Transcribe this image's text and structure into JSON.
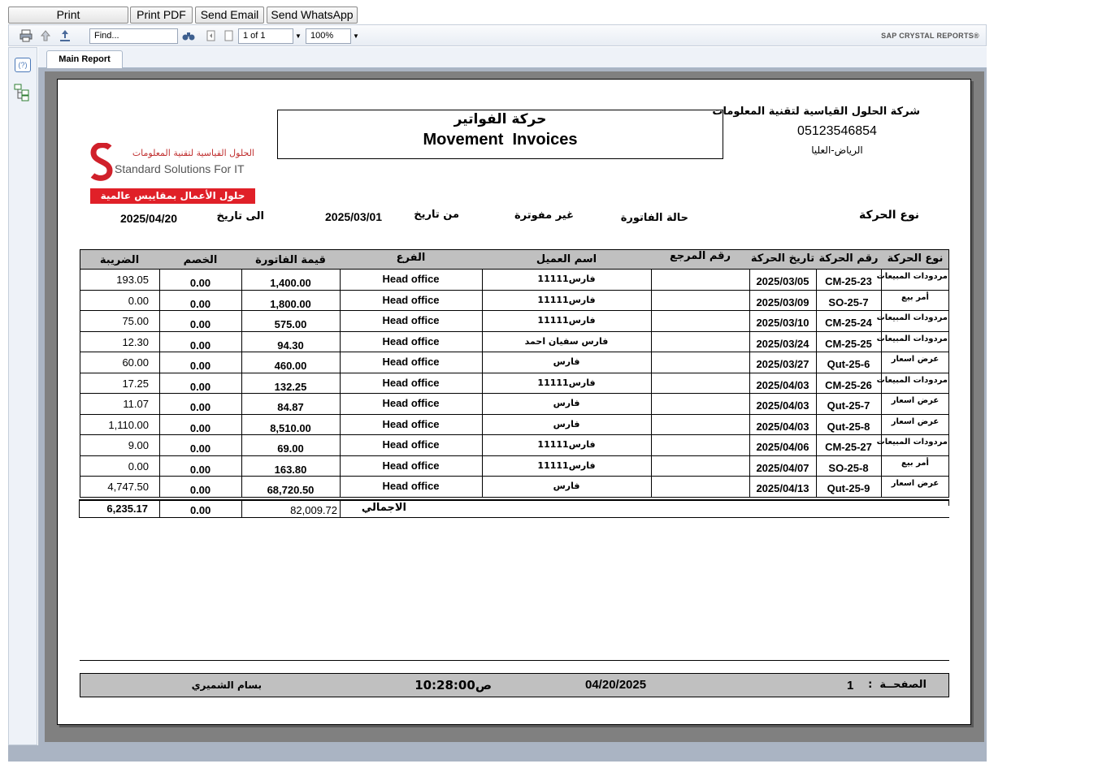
{
  "top_buttons": {
    "print": "Print",
    "print_pdf": "Print PDF",
    "send_email": "Send Email",
    "send_whatsapp": "Send WhatsApp"
  },
  "toolbar": {
    "find_placeholder": "Find...",
    "page_indicator": "1 of 1",
    "zoom": "100%",
    "brand": "SAP CRYSTAL REPORTS®"
  },
  "tab": {
    "label": "Main Report"
  },
  "leftpanel": {
    "help_label": "(?)"
  },
  "report": {
    "company_name": "شركة الحلول القياسية لتقنية المعلومات",
    "phone": "05123546854",
    "city": "الرياض-العليا",
    "title_ar": "حركة الفواتير",
    "title_en": "Movement  Invoices",
    "logo": {
      "ar_top": "الحلول القياسية لتقنية المعلومات",
      "en": "Standard Solutions For IT",
      "ar_banner": "حلول الأعمال بمقاييس عالمية"
    },
    "filters": {
      "to_date_label": "الى تاريخ",
      "to_date": "2025/04/20",
      "from_date_label": "من تاريخ",
      "from_date": "2025/03/01",
      "status_value": "غير مفوترة",
      "status_label": "حالة الفاتورة",
      "type_label": "نوع الحركة"
    },
    "columns": {
      "type": "نوع الحركة",
      "number": "رقم الحركة",
      "date": "تاريخ الحركة",
      "ref": "رقم المرجع",
      "customer": "اسم العميل",
      "branch": "الفرع",
      "amount": "قيمة الفاتورة",
      "discount": "الخصم",
      "tax": "الضريبة"
    },
    "rows": [
      {
        "type": "مردودات المبيعات",
        "number": "CM-25-23",
        "date": "2025/03/05",
        "ref": "",
        "customer": "فارس11111",
        "branch": "Head office",
        "amount": "1,400.00",
        "discount": "0.00",
        "tax": "193.05"
      },
      {
        "type": "أمر بيع",
        "number": "SO-25-7",
        "date": "2025/03/09",
        "ref": "",
        "customer": "فارس11111",
        "branch": "Head office",
        "amount": "1,800.00",
        "discount": "0.00",
        "tax": "0.00"
      },
      {
        "type": "مردودات المبيعات",
        "number": "CM-25-24",
        "date": "2025/03/10",
        "ref": "",
        "customer": "فارس11111",
        "branch": "Head office",
        "amount": "575.00",
        "discount": "0.00",
        "tax": "75.00"
      },
      {
        "type": "مردودات المبيعات",
        "number": "CM-25-25",
        "date": "2025/03/24",
        "ref": "",
        "customer": "فارس سفيان احمد",
        "branch": "Head office",
        "amount": "94.30",
        "discount": "0.00",
        "tax": "12.30"
      },
      {
        "type": "عرض اسعار",
        "number": "Qut-25-6",
        "date": "2025/03/27",
        "ref": "",
        "customer": "فارس",
        "branch": "Head office",
        "amount": "460.00",
        "discount": "0.00",
        "tax": "60.00"
      },
      {
        "type": "مردودات المبيعات",
        "number": "CM-25-26",
        "date": "2025/04/03",
        "ref": "",
        "customer": "فارس11111",
        "branch": "Head office",
        "amount": "132.25",
        "discount": "0.00",
        "tax": "17.25"
      },
      {
        "type": "عرض اسعار",
        "number": "Qut-25-7",
        "date": "2025/04/03",
        "ref": "",
        "customer": "فارس",
        "branch": "Head office",
        "amount": "84.87",
        "discount": "0.00",
        "tax": "11.07"
      },
      {
        "type": "عرض اسعار",
        "number": "Qut-25-8",
        "date": "2025/04/03",
        "ref": "",
        "customer": "فارس",
        "branch": "Head office",
        "amount": "8,510.00",
        "discount": "0.00",
        "tax": "1,110.00"
      },
      {
        "type": "مردودات المبيعات",
        "number": "CM-25-27",
        "date": "2025/04/06",
        "ref": "",
        "customer": "فارس11111",
        "branch": "Head office",
        "amount": "69.00",
        "discount": "0.00",
        "tax": "9.00"
      },
      {
        "type": "أمر بيع",
        "number": "SO-25-8",
        "date": "2025/04/07",
        "ref": "",
        "customer": "فارس11111",
        "branch": "Head office",
        "amount": "163.80",
        "discount": "0.00",
        "tax": "0.00"
      },
      {
        "type": "عرض اسعار",
        "number": "Qut-25-9",
        "date": "2025/04/13",
        "ref": "",
        "customer": "فارس",
        "branch": "Head office",
        "amount": "68,720.50",
        "discount": "0.00",
        "tax": "4,747.50"
      }
    ],
    "totals": {
      "label": "الاجمالي",
      "amount": "82,009.72",
      "discount": "0.00",
      "tax": "6,235.17"
    },
    "footer": {
      "page_label": "الصفحــة  :",
      "page_number": "1",
      "date": "04/20/2025",
      "time": "ص10:28:00",
      "user": "بسام الشميري"
    }
  }
}
